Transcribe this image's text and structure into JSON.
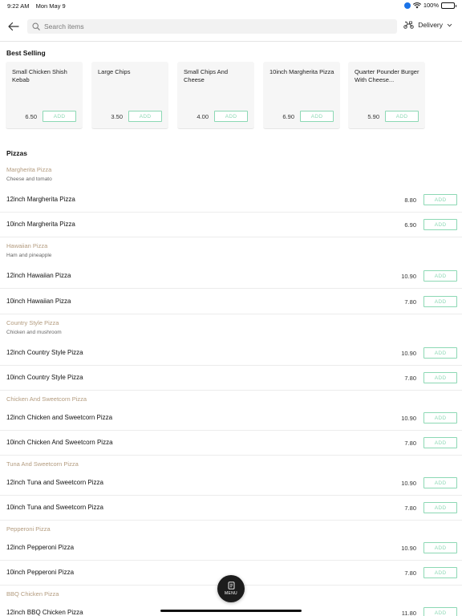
{
  "status_bar": {
    "time": "9:22 AM",
    "date": "Mon May 9",
    "battery": "100%"
  },
  "header": {
    "search_placeholder": "Search items",
    "delivery_label": "Delivery"
  },
  "best_selling": {
    "title": "Best Selling",
    "add_label": "ADD",
    "items": [
      {
        "name": "Small Chicken Shish Kebab",
        "price": "6.50"
      },
      {
        "name": "Large Chips",
        "price": "3.50"
      },
      {
        "name": "Small Chips And Cheese",
        "price": "4.00"
      },
      {
        "name": "10inch Margherita Pizza",
        "price": "6.90"
      },
      {
        "name": "Quarter Pounder Burger With Cheese...",
        "price": "5.90"
      }
    ]
  },
  "pizzas": {
    "title": "Pizzas",
    "add_label": "ADD",
    "groups": [
      {
        "title": "Margherita Pizza",
        "subtitle": "Cheese and tomato",
        "items": [
          {
            "name": "12inch Margherita Pizza",
            "price": "8.80"
          },
          {
            "name": "10inch Margherita Pizza",
            "price": "6.90"
          }
        ]
      },
      {
        "title": "Hawaiian Pizza",
        "subtitle": "Ham and pineapple",
        "items": [
          {
            "name": "12inch Hawaiian Pizza",
            "price": "10.90"
          },
          {
            "name": "10inch Hawaiian Pizza",
            "price": "7.80"
          }
        ]
      },
      {
        "title": "Country Style Pizza",
        "subtitle": "Chicken and mushroom",
        "items": [
          {
            "name": "12inch Country Style Pizza",
            "price": "10.90"
          },
          {
            "name": "10inch Country Style Pizza",
            "price": "7.80"
          }
        ]
      },
      {
        "title": "Chicken And Sweetcorn Pizza",
        "subtitle": "",
        "items": [
          {
            "name": "12inch Chicken and Sweetcorn Pizza",
            "price": "10.90"
          },
          {
            "name": "10inch Chicken And Sweetcorn Pizza",
            "price": "7.80"
          }
        ]
      },
      {
        "title": "Tuna And Sweetcorn Pizza",
        "subtitle": "",
        "items": [
          {
            "name": "12inch Tuna and Sweetcorn Pizza",
            "price": "10.90"
          },
          {
            "name": "10inch Tuna and Sweetcorn Pizza",
            "price": "7.80"
          }
        ]
      },
      {
        "title": "Pepperoni Pizza",
        "subtitle": "",
        "items": [
          {
            "name": "12inch Pepperoni Pizza",
            "price": "10.90"
          },
          {
            "name": "10inch Pepperoni Pizza",
            "price": "7.80"
          }
        ]
      },
      {
        "title": "BBQ Chicken Pizza",
        "subtitle": "",
        "items": [
          {
            "name": "12inch BBQ Chicken Pizza",
            "price": "11.80"
          }
        ]
      }
    ]
  },
  "menu_button": {
    "label": "MENU"
  }
}
